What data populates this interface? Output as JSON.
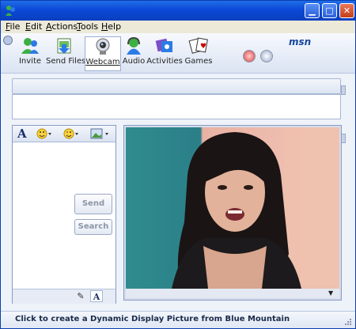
{
  "window": {
    "minimize_glyph": "▁",
    "maximize_glyph": "□",
    "close_glyph": "✕"
  },
  "menu": [
    {
      "label": "File",
      "accel": "F",
      "rest": "ile"
    },
    {
      "label": "Edit",
      "accel": "E",
      "rest": "dit"
    },
    {
      "label": "Actions",
      "accel": "A",
      "rest": "ctions"
    },
    {
      "label": "Tools",
      "accel": "T",
      "rest": "ools"
    },
    {
      "label": "Help",
      "accel": "H",
      "rest": "elp"
    }
  ],
  "toolbar": {
    "items": [
      {
        "label": "Invite",
        "icon": "invite-icon"
      },
      {
        "label": "Send Files",
        "icon": "send-files-icon"
      },
      {
        "label": "Webcam",
        "icon": "webcam-icon",
        "active": true
      },
      {
        "label": "Audio",
        "icon": "audio-icon"
      },
      {
        "label": "Activities",
        "icon": "activities-icon"
      },
      {
        "label": "Games",
        "icon": "games-icon"
      }
    ],
    "brand": "msn"
  },
  "compose": {
    "send_label": "Send",
    "search_label": "Search",
    "font_glyph": "A",
    "handwriting_tab_glyph": "✎",
    "text_tab_glyph": "A"
  },
  "status": {
    "text": "Click to create a Dynamic Display Picture from Blue Mountain"
  },
  "colors": {
    "title_bar": "#0b49d6",
    "accent": "#16469a",
    "close_button": "#c23e1a"
  }
}
